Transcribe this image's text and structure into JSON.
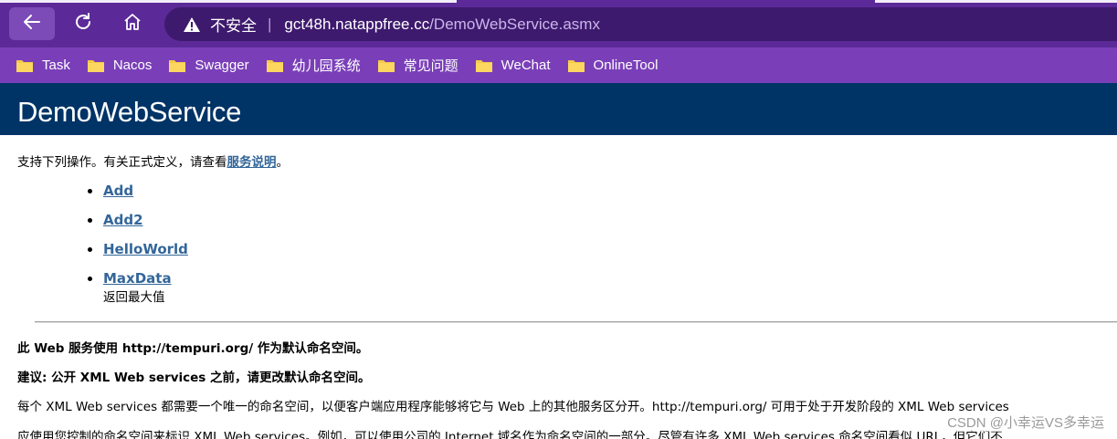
{
  "browser": {
    "nav": {
      "back_icon": "back-arrow-icon",
      "reload_icon": "reload-icon",
      "home_icon": "home-icon"
    },
    "address_bar": {
      "security_icon": "warning-triangle-icon",
      "security_text": "不安全",
      "separator": "|",
      "host": "gct48h.natappfree.cc",
      "path": "/DemoWebService.asmx"
    },
    "bookmarks": [
      {
        "label": "Task",
        "icon": "folder-icon"
      },
      {
        "label": "Nacos",
        "icon": "folder-icon"
      },
      {
        "label": "Swagger",
        "icon": "folder-icon"
      },
      {
        "label": "幼儿园系统",
        "icon": "folder-icon"
      },
      {
        "label": "常见问题",
        "icon": "folder-icon"
      },
      {
        "label": "WeChat",
        "icon": "folder-icon"
      },
      {
        "label": "OnlineTool",
        "icon": "folder-icon"
      }
    ],
    "colors": {
      "toolbar": "#5b2a98",
      "bookmarks_bar": "#7a3fb8",
      "folder": "#f7c948"
    }
  },
  "page": {
    "banner_title": "DemoWebService",
    "intro_prefix": "支持下列操作。有关正式定义，请查看",
    "intro_link": "服务说明",
    "intro_suffix": "。",
    "operations": [
      {
        "name": "Add",
        "desc": ""
      },
      {
        "name": "Add2",
        "desc": ""
      },
      {
        "name": "HelloWorld",
        "desc": ""
      },
      {
        "name": "MaxData",
        "desc": "返回最大值"
      }
    ],
    "namespace_note": "此 Web 服务使用 http://tempuri.org/ 作为默认命名空间。",
    "recommendation": "建议: 公开 XML Web services 之前，请更改默认命名空间。",
    "para1": "每个 XML Web services 都需要一个唯一的命名空间，以便客户端应用程序能够将它与 Web 上的其他服务区分开。http://tempuri.org/ 可用于处于开发阶段的 XML Web services",
    "para2": "应使用您控制的命名空间来标识 XML Web services。例如，可以使用公司的 Internet 域名作为命名空间的一部分。尽管有许多 XML Web services 命名空间看似 URL，但它们不",
    "colors": {
      "banner": "#003366",
      "link": "#336699"
    }
  },
  "watermark": "CSDN @小幸运VS多幸运"
}
